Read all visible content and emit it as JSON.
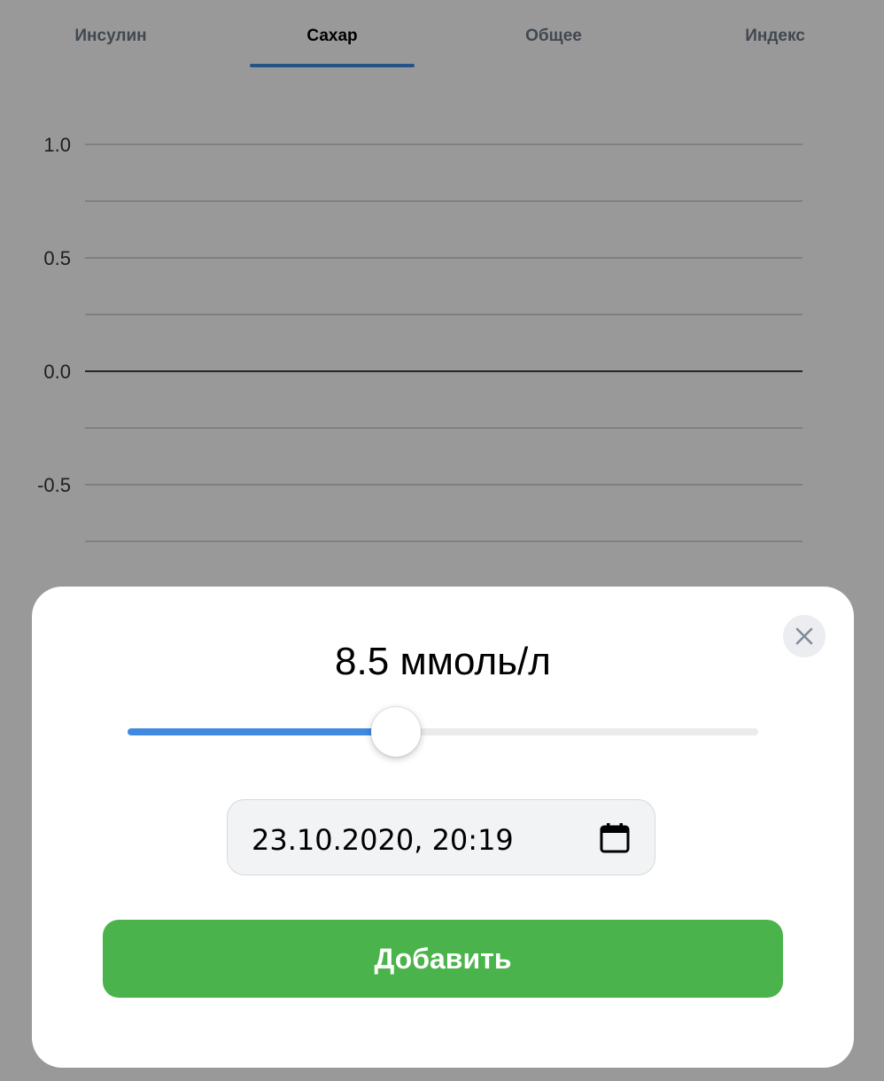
{
  "tabs": [
    {
      "label": "Инсулин",
      "active": false
    },
    {
      "label": "Сахар",
      "active": true
    },
    {
      "label": "Общее",
      "active": false
    },
    {
      "label": "Индекс",
      "active": false
    }
  ],
  "colors": {
    "accent": "#3f8ae0",
    "button": "#4bb34b",
    "inactive_tab": "#6d7885"
  },
  "chart_data": {
    "type": "line",
    "title": "",
    "xlabel": "",
    "ylabel": "",
    "ylim": [
      -1.0,
      1.0
    ],
    "y_ticks": [
      1.0,
      0.5,
      0.0,
      -0.5
    ],
    "y_tick_labels": [
      "1.0",
      "0.5",
      "0.0",
      "-0.5"
    ],
    "grid": true,
    "series": []
  },
  "modal": {
    "value_text": "8.5 ммоль/л",
    "slider": {
      "fraction": 0.425
    },
    "date_value": "23.10.2020, 20:19",
    "add_label": "Добавить",
    "close_icon": "close-icon",
    "calendar_icon": "calendar-icon"
  }
}
